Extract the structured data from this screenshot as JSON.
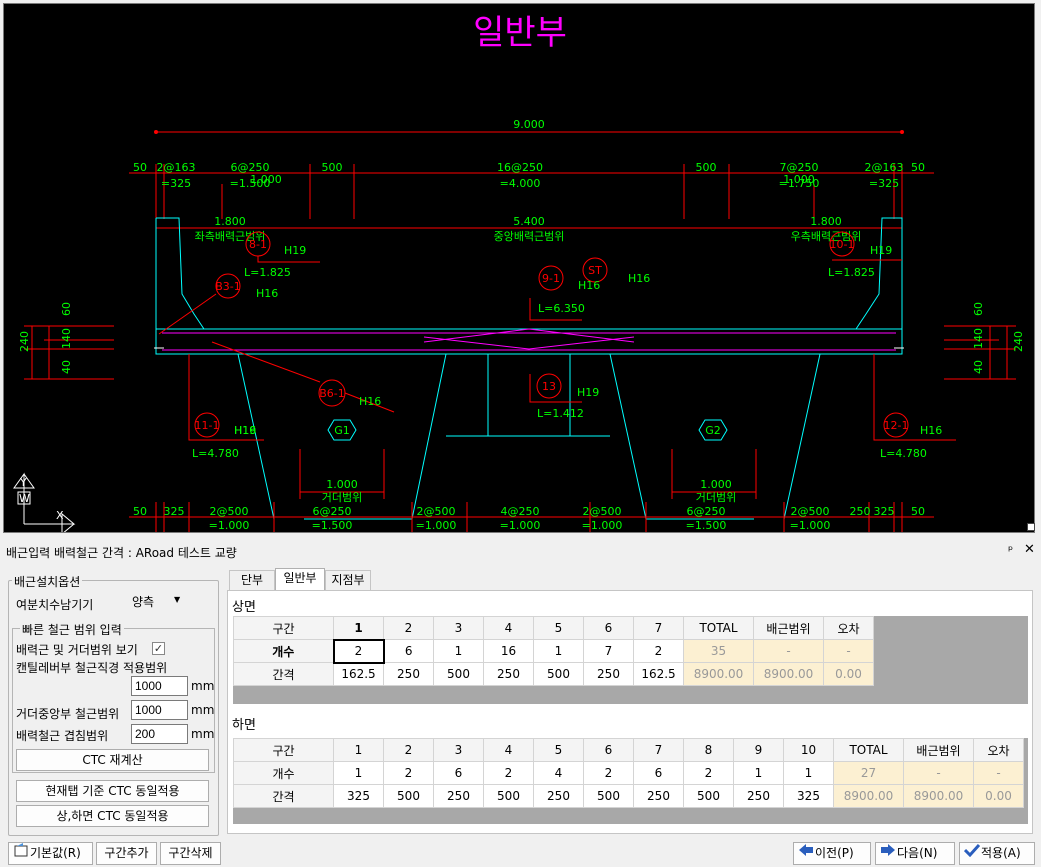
{
  "drawing": {
    "title": "일반부",
    "colors": {
      "bg": "#000000",
      "dim": "#ff0000",
      "text": "#00ff00",
      "struct": "#00ffff",
      "rebar": "#ff00ff",
      "white": "#ffffff",
      "title": "#ff00ff"
    },
    "top_total": "9.000",
    "top_row1": [
      "50",
      "2@163",
      "6@250",
      "500",
      "16@250",
      "500",
      "7@250",
      "2@163",
      "50"
    ],
    "top_row2": [
      "=325",
      "=1.500",
      "1.000",
      "=4.000",
      "1.000",
      "=1.750",
      "=325"
    ],
    "mid_row": [
      "1.800",
      "5.400",
      "1.800"
    ],
    "range_labels": [
      "좌측배력근범위",
      "중앙배력근범위",
      "우측배력근범위"
    ],
    "bubbles": [
      "8-1",
      "B3-1",
      "9-1",
      "ST",
      "13",
      "B6-1",
      "11-1",
      "12-1",
      "10-1"
    ],
    "rebar_notes": [
      "H19",
      "L=1.825",
      "H16",
      "H16",
      "H16",
      "L=6.350",
      "H16",
      "H19",
      "L=1.825",
      "H16",
      "H19",
      "L=1.412",
      "H19",
      "L=4.780",
      "H16",
      "L=4.780"
    ],
    "girders": [
      "G1",
      "G2"
    ],
    "girder_range": [
      "1.000",
      "거더범위",
      "1.000",
      "거더범위"
    ],
    "bottom_row1": [
      "50",
      "325",
      "2@500",
      "6@250",
      "2@500",
      "4@250",
      "2@500",
      "6@250",
      "2@500",
      "250",
      "325",
      "50"
    ],
    "bottom_row2": [
      "=1.000",
      "=1.500",
      "=1.000",
      "=1.000",
      "=1.000",
      "=1.500",
      "=1.000"
    ],
    "left_dims": [
      "60",
      "140",
      "40",
      "240"
    ],
    "right_dims": [
      "60",
      "140",
      "40",
      "240"
    ],
    "axis": [
      "Y",
      "W",
      "X"
    ]
  },
  "panel": {
    "title": "배근입력 배력철근 간격 : ARoad 테스트 교량",
    "pin": "ᵖ",
    "close": "✕"
  },
  "options": {
    "group_title": "배근설치옵션",
    "bearing_label": "여분치수남기기",
    "bearing_value": "양측",
    "quick_title": "빠른 철근 범위 입력",
    "show_label": "배력근 및 거더범위 보기",
    "show_checked": "✓",
    "cant_label": "캔틸레버부 철근직경 적용범위",
    "cant_value": "1000",
    "girder_label": "거더중앙부 철근범위",
    "girder_value": "1000",
    "overlap_label": "배력철근 겹침범위",
    "overlap_value": "200",
    "unit": "mm",
    "recalc_button": "CTC 재계산",
    "apply_tab_button": "현재탭 기준 CTC 동일적용",
    "apply_updown_button": "상,하면 CTC 동일적용"
  },
  "tabs": [
    "단부",
    "일반부",
    "지점부"
  ],
  "upper": {
    "title": "상면",
    "row_labels": [
      "구간",
      "개수",
      "간격"
    ],
    "headers": [
      "1",
      "2",
      "3",
      "4",
      "5",
      "6",
      "7",
      "TOTAL",
      "배근범위",
      "오차"
    ],
    "counts": [
      "2",
      "6",
      "1",
      "16",
      "1",
      "7",
      "2",
      "35",
      "-",
      "-"
    ],
    "spacings": [
      "162.5",
      "250",
      "500",
      "250",
      "500",
      "250",
      "162.5",
      "8900.00",
      "8900.00",
      "0.00"
    ]
  },
  "lower": {
    "title": "하면",
    "row_labels": [
      "구간",
      "개수",
      "간격"
    ],
    "headers": [
      "1",
      "2",
      "3",
      "4",
      "5",
      "6",
      "7",
      "8",
      "9",
      "10",
      "TOTAL",
      "배근범위",
      "오차"
    ],
    "counts": [
      "1",
      "2",
      "6",
      "2",
      "4",
      "2",
      "6",
      "2",
      "1",
      "1",
      "27",
      "-",
      "-"
    ],
    "spacings": [
      "325",
      "500",
      "250",
      "500",
      "250",
      "500",
      "250",
      "500",
      "250",
      "325",
      "8900.00",
      "8900.00",
      "0.00"
    ]
  },
  "bottom_buttons": {
    "default": "기본값(R)",
    "add": "구간추가",
    "delete": "구간삭제",
    "prev": "이전(P)",
    "next": "다음(N)",
    "apply": "적용(A)"
  }
}
